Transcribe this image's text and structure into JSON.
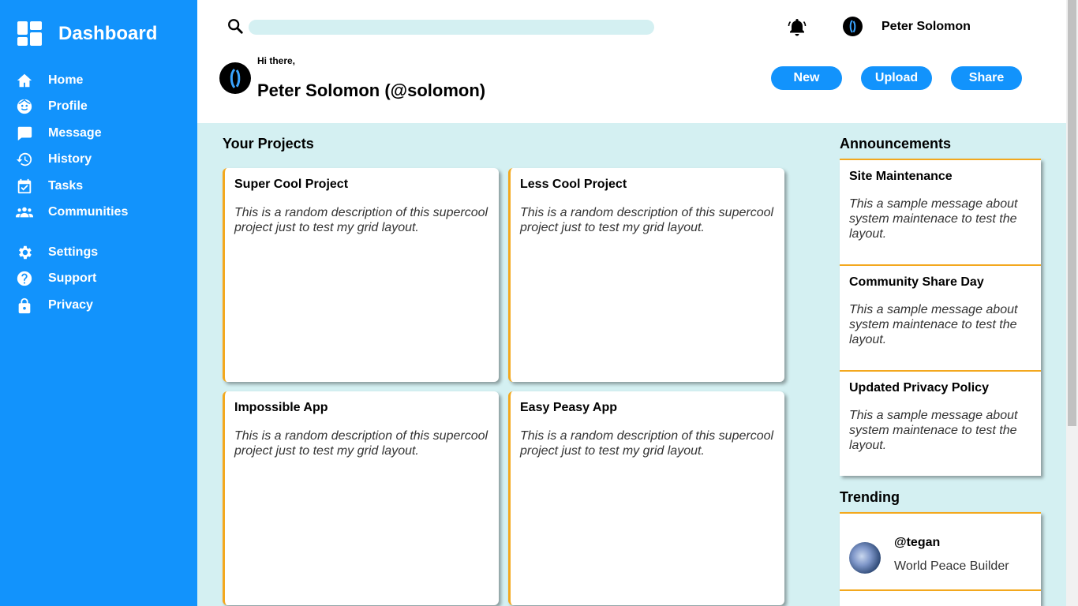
{
  "sidebar": {
    "brand": "Dashboard",
    "items": [
      {
        "label": "Home",
        "icon": "home-icon"
      },
      {
        "label": "Profile",
        "icon": "profile-icon"
      },
      {
        "label": "Message",
        "icon": "message-icon"
      },
      {
        "label": "History",
        "icon": "history-icon"
      },
      {
        "label": "Tasks",
        "icon": "tasks-icon"
      },
      {
        "label": "Communities",
        "icon": "communities-icon"
      },
      {
        "label": "Settings",
        "icon": "gear-icon"
      },
      {
        "label": "Support",
        "icon": "help-icon"
      },
      {
        "label": "Privacy",
        "icon": "lock-icon"
      }
    ]
  },
  "header": {
    "search_placeholder": "",
    "user_name": "Peter Solomon",
    "greeting": "Hi there,",
    "full_name": "Peter Solomon (@solomon)",
    "buttons": {
      "new": "New",
      "upload": "Upload",
      "share": "Share"
    }
  },
  "projects": {
    "title": "Your Projects",
    "cards": [
      {
        "title": "Super Cool Project",
        "description": "This is a random description of this supercool project just to test my grid layout."
      },
      {
        "title": "Less Cool Project",
        "description": "This is a random description of this supercool project just to test my grid layout."
      },
      {
        "title": "Impossible App",
        "description": "This is a random description of this supercool project just to test my grid layout."
      },
      {
        "title": "Easy Peasy App",
        "description": "This is a random description of this supercool project just to test my grid layout."
      }
    ]
  },
  "announcements": {
    "title": "Announcements",
    "items": [
      {
        "title": "Site Maintenance",
        "body": "This a sample message about system maintenace to test the layout."
      },
      {
        "title": "Community Share Day",
        "body": "This a sample message about system maintenace to test the layout."
      },
      {
        "title": "Updated Privacy Policy",
        "body": "This a sample message about system maintenace to test the layout."
      }
    ]
  },
  "trending": {
    "title": "Trending",
    "items": [
      {
        "handle": "@tegan",
        "role": "World Peace Builder"
      }
    ]
  },
  "colors": {
    "sidebar": "#1293fc",
    "accent": "#f3a81e",
    "background": "#d4f0f2"
  }
}
